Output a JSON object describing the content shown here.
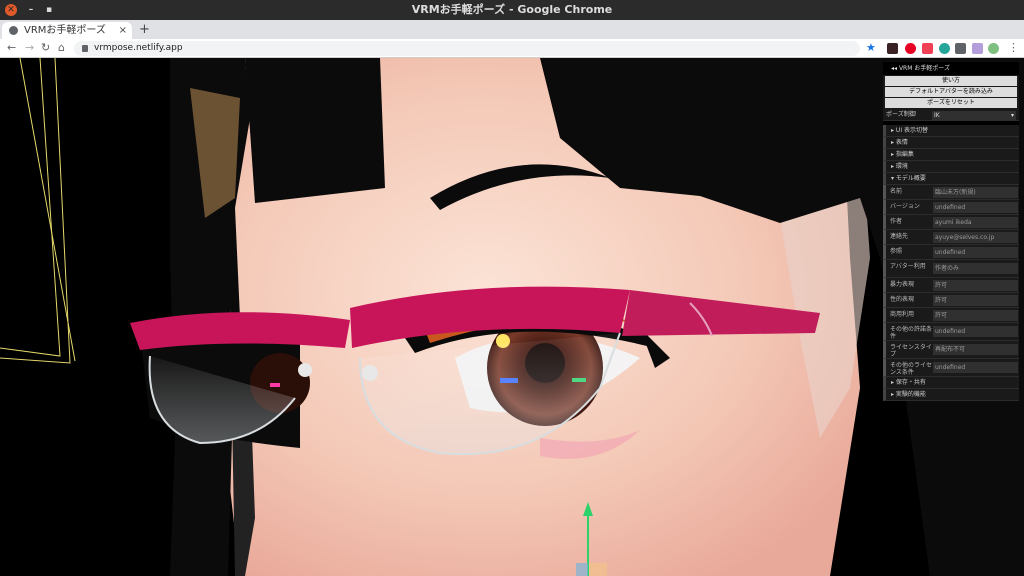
{
  "window": {
    "title": "VRMお手軽ポーズ - Google Chrome"
  },
  "tab": {
    "title": "VRMお手軽ポーズ",
    "close": "×",
    "new": "+"
  },
  "toolbar": {
    "url": "vrmpose.netlify.app",
    "back": "←",
    "forward": "→",
    "reload": "↻",
    "home": "⌂",
    "star": "★",
    "menu": "⋮"
  },
  "panel": {
    "header": "VRM お手軽ポーズ",
    "buttons": [
      "使い方",
      "デフォルトアバターを読み込み",
      "ポーズをリセット"
    ],
    "pose_control": {
      "label": "ポーズ制御",
      "value": "IK"
    },
    "folders": [
      "UI 表示切替",
      "表情",
      "指編集",
      "環境",
      "モデル概要"
    ],
    "model_info": [
      {
        "key": "名前",
        "value": "臨山未万(新規)"
      },
      {
        "key": "バージョン",
        "value": "undefined"
      },
      {
        "key": "作者",
        "value": "ayumi ikeda"
      },
      {
        "key": "連絡先",
        "value": "ayuye@selves.co.jp"
      },
      {
        "key": "参照",
        "value": "undefined"
      },
      {
        "key": "アバター利用",
        "value": "作者のみ"
      },
      {
        "key": "暴力表現",
        "value": "許可"
      },
      {
        "key": "性的表現",
        "value": "許可"
      },
      {
        "key": "商用利用",
        "value": "許可"
      },
      {
        "key": "その他の許諾条件",
        "value": "undefined"
      },
      {
        "key": "ライセンスタイプ",
        "value": "再配布不可"
      },
      {
        "key": "その他のライセンス条件",
        "value": "undefined"
      }
    ],
    "footer_folders": [
      "保存・共有",
      "実験的機能"
    ]
  },
  "colors": {
    "frame": "#c8155a",
    "iris": "#5a2a1c",
    "skin": "#f4c8b6",
    "hair": "#0c0b0b",
    "gizmo_y": "#2ed26a"
  }
}
